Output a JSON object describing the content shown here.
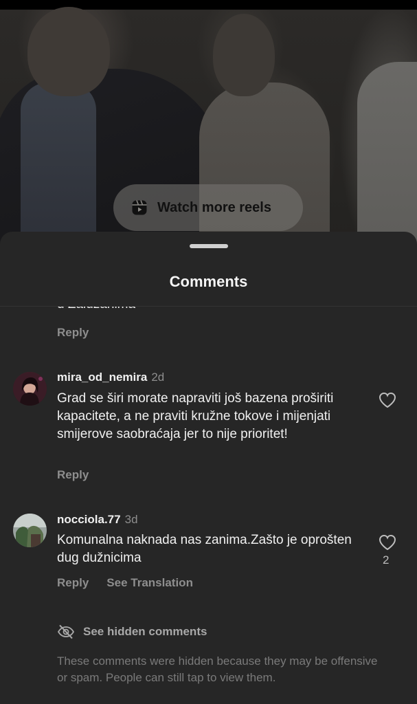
{
  "video": {
    "watch_more_label": "Watch more reels"
  },
  "sheet": {
    "title": "Comments",
    "partial_comment_text": "u Zaluzanima",
    "partial_reply_label": "Reply"
  },
  "comments": [
    {
      "username": "mira_od_nemira",
      "time": "2d",
      "text": "Grad se širi morate napraviti još bazena proširiti kapacitete, a ne praviti kružne tokove i mijenjati smijerove saobraćaja jer to nije prioritet!",
      "reply_label": "Reply",
      "like_count": ""
    },
    {
      "username": "nocciola.77",
      "time": "3d",
      "text": "Komunalna naknada nas zanima.Zašto je oprošten dug dužnicima",
      "reply_label": "Reply",
      "see_translation_label": "See Translation",
      "like_count": "2"
    }
  ],
  "hidden": {
    "label": "See hidden comments",
    "note": "These comments were hidden because they may be offensive or spam. People can still tap to view them."
  },
  "icons": {
    "reels": "reels-icon",
    "heart": "heart-icon",
    "hidden": "eye-slash-icon"
  }
}
